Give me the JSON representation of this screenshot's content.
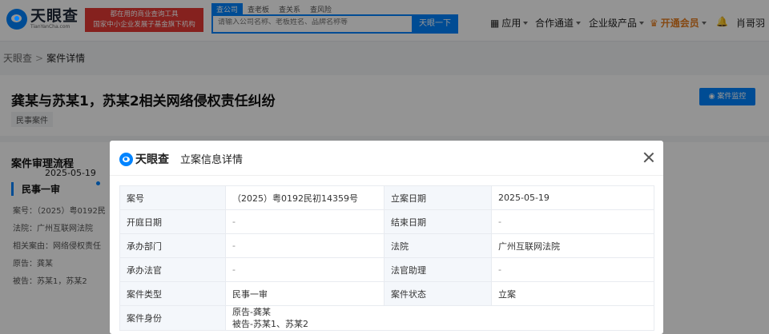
{
  "header": {
    "logo_cn": "天眼查",
    "logo_en": "TianYanCha.com",
    "slogan_line1": "都在用的商业查询工具",
    "slogan_line2": "国家中小企业发展子基金旗下机构",
    "search_tabs": [
      "查公司",
      "查老板",
      "查关系",
      "查风险"
    ],
    "search_placeholder": "请输入公司名称、老板姓名、品牌名称等",
    "search_button": "天眼一下",
    "nav": {
      "app": "应用",
      "cooperation": "合作通道",
      "enterprise": "企业级产品",
      "vip": "开通会员",
      "user": "肖哥羽"
    },
    "accent_color": "#0084ff",
    "vip_color": "#e67e22"
  },
  "breadcrumb": {
    "home": "天眼查",
    "current": "案件详情"
  },
  "case": {
    "title": "龚某与苏某1，苏某2相关网络侵权责任纠纷",
    "tag": "民事案件",
    "monitor_button": "案件监控"
  },
  "flow": {
    "title": "案件审理流程",
    "stage": "民事一审",
    "lines": [
      "案号：（2025）粤0192民",
      "法院：广州互联网法院",
      "相关案由：网络侵权责任",
      "原告：龚某",
      "被告：苏某1，苏某2"
    ],
    "date": "2025-05-19"
  },
  "modal": {
    "logo": "天眼查",
    "title": "立案信息详情",
    "rows": [
      {
        "k1": "案号",
        "v1": "（2025）粤0192民初14359号",
        "k2": "立案日期",
        "v2": "2025-05-19"
      },
      {
        "k1": "开庭日期",
        "v1": "-",
        "k2": "结束日期",
        "v2": "-"
      },
      {
        "k1": "承办部门",
        "v1": "-",
        "k2": "法院",
        "v2": "广州互联网法院"
      },
      {
        "k1": "承办法官",
        "v1": "-",
        "k2": "法官助理",
        "v2": "-"
      },
      {
        "k1": "案件类型",
        "v1": "民事一审",
        "k2": "案件状态",
        "v2": "立案"
      }
    ],
    "identity_label": "案件身份",
    "identity_lines": [
      "原告-龚某",
      "被告-苏某1、苏某2"
    ]
  }
}
